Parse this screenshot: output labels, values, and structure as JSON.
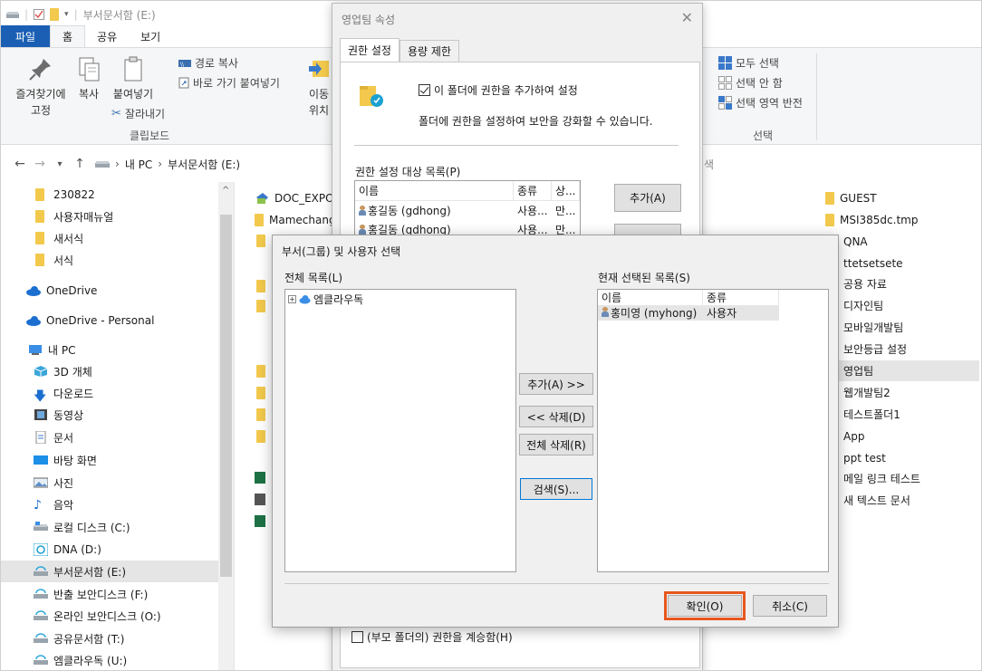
{
  "window": {
    "title": "부서문서함 (E:)"
  },
  "ribbon_tabs": {
    "file": "파일",
    "home": "홈",
    "share": "공유",
    "view": "보기"
  },
  "ribbon": {
    "pin": "즐겨찾기에",
    "pin2": "고정",
    "copy": "복사",
    "paste": "붙여넣기",
    "copy_path": "경로 복사",
    "paste_shortcut": "바로 가기 붙여넣기",
    "cut": "잘라내기",
    "clipboard_group": "클립보드",
    "move": "이동",
    "move2": "위치",
    "select_all": "모두 선택",
    "select_none": "선택 안 함",
    "invert": "선택 영역 반전",
    "select_group": "선택"
  },
  "address": {
    "crumb1": "내 PC",
    "crumb2": "부서문서함 (E:)",
    "search_hint": "색"
  },
  "left_nav": [
    "230822",
    "사용자매뉴얼",
    "새서식",
    "서식",
    "OneDrive",
    "OneDrive - Personal",
    "내 PC",
    "3D 개체",
    "다운로드",
    "동영상",
    "문서",
    "바탕 화면",
    "사진",
    "음악",
    "로컬 디스크 (C:)",
    "DNA (D:)",
    "부서문서함 (E:)",
    "반출 보안디스크 (F:)",
    "온라인 보안디스크 (O:)",
    "공유문서함 (T:)",
    "엠클라우독 (U:)"
  ],
  "mid_list": [
    "DOC_EXPOR",
    "Mamechang"
  ],
  "right_list": [
    "GUEST",
    "MSI385dc.tmp",
    "QNA",
    "ttetsetsete",
    "공용 자료",
    "디자인팀",
    "모바일개발팀",
    "보안등급 설정",
    "영업팀",
    "웹개발팀2",
    "테스트폴더1",
    "App",
    "ppt test",
    "메일 링크 테스트",
    "새 텍스트 문서"
  ],
  "properties": {
    "title": "영업팀 속성",
    "tab_perm": "권한 설정",
    "tab_quota": "용량 제한",
    "add_perm_check": "이 폴더에 권한을 추가하여 설정",
    "desc": "폴더에 권한을 설정하여 보안을 강화할 수 있습니다.",
    "target_list_label": "권한 설정 대상 목록(P)",
    "col_name": "이름",
    "col_type": "종류",
    "col_status": "상...",
    "rows": [
      {
        "name": "홍길동 (gdhong)",
        "type": "사용...",
        "status": "만..."
      },
      {
        "name": "홍길동 (gdhong)",
        "type": "사용...",
        "status": "만..."
      }
    ],
    "add_btn": "추가(A)",
    "inherit_check": "(부모 폴더의) 권한을 계승함(H)"
  },
  "select_dialog": {
    "title": "부서(그룹) 및 사용자 선택",
    "all_list_label": "전체 목록(L)",
    "tree_root": "엠클라우독",
    "selected_label": "현재 선택된 목록(S)",
    "col_name": "이름",
    "col_type": "종류",
    "selected_rows": [
      {
        "name": "홍미영 (myhong)",
        "type": "사용자"
      }
    ],
    "add_btn": "추가(A) >>",
    "del_btn": "<< 삭제(D)",
    "del_all_btn": "전체 삭제(R)",
    "search_btn": "검색(S)...",
    "ok_btn": "확인(O)",
    "cancel_btn": "취소(C)"
  },
  "colors": {
    "accent": "#1a5fb4",
    "highlight": "#e8571e",
    "folder": "#f2c94c"
  }
}
